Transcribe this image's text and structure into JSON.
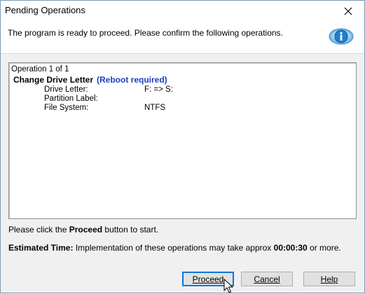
{
  "window": {
    "title": "Pending Operations"
  },
  "header": {
    "text": "The program is ready to proceed. Please confirm the following operations."
  },
  "operations": {
    "count_line": "Operation 1 of 1",
    "op_title": "Change Drive Letter",
    "op_note": "(Reboot required)",
    "fields": [
      {
        "label": "Drive Letter:",
        "value": "F: => S:"
      },
      {
        "label": "Partition Label:",
        "value": ""
      },
      {
        "label": "File System:",
        "value": "NTFS"
      }
    ]
  },
  "hint": {
    "prefix": "Please click the ",
    "bold": "Proceed",
    "suffix": " button to start."
  },
  "estimate": {
    "label": "Estimated Time:",
    "text": " Implementation of these operations may take approx ",
    "time": "00:00:30",
    "suffix": " or more."
  },
  "buttons": {
    "proceed": "Proceed",
    "cancel": "Cancel",
    "help": "Help"
  },
  "colors": {
    "accent": "#0078d7",
    "reboot_text": "#1a3fbf"
  },
  "icons": {
    "close": "close-icon",
    "info": "info-icon",
    "cursor": "mouse-pointer-icon"
  }
}
